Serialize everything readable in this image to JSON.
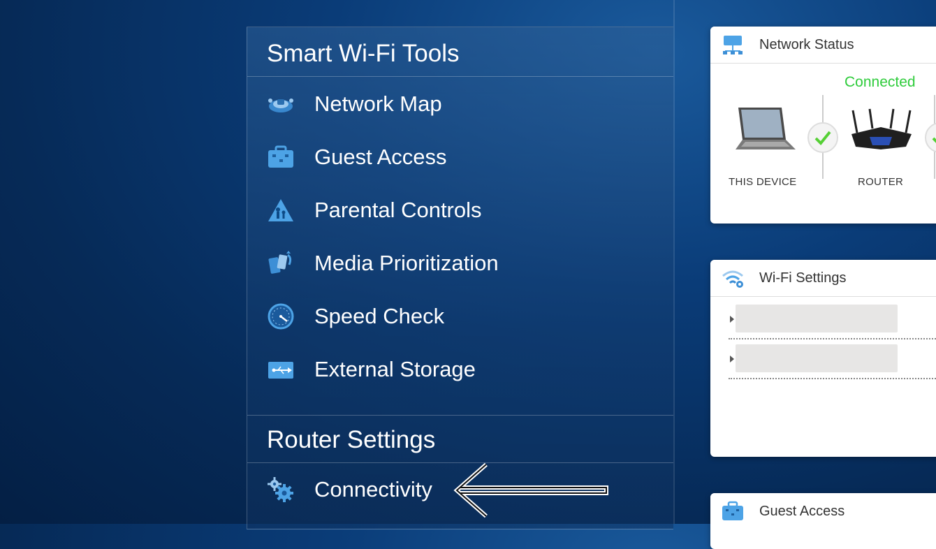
{
  "tools_panel": {
    "title": "Smart Wi-Fi Tools",
    "items": [
      {
        "label": "Network Map",
        "icon": "network-map-icon"
      },
      {
        "label": "Guest Access",
        "icon": "guest-access-icon"
      },
      {
        "label": "Parental Controls",
        "icon": "parental-controls-icon"
      },
      {
        "label": "Media Prioritization",
        "icon": "media-prioritization-icon"
      },
      {
        "label": "Speed Check",
        "icon": "speed-check-icon"
      },
      {
        "label": "External Storage",
        "icon": "external-storage-icon"
      }
    ]
  },
  "router_settings": {
    "title": "Router Settings",
    "items": [
      {
        "label": "Connectivity",
        "icon": "gears-icon"
      }
    ]
  },
  "widgets": {
    "network_status": {
      "title": "Network Status",
      "status": "Connected",
      "this_device_label": "THIS DEVICE",
      "router_label": "ROUTER"
    },
    "wifi_settings": {
      "title": "Wi-Fi Settings"
    },
    "guest_access": {
      "title": "Guest Access"
    }
  },
  "colors": {
    "status_green": "#2fcc3c",
    "icon_blue": "#3d8fd6"
  }
}
